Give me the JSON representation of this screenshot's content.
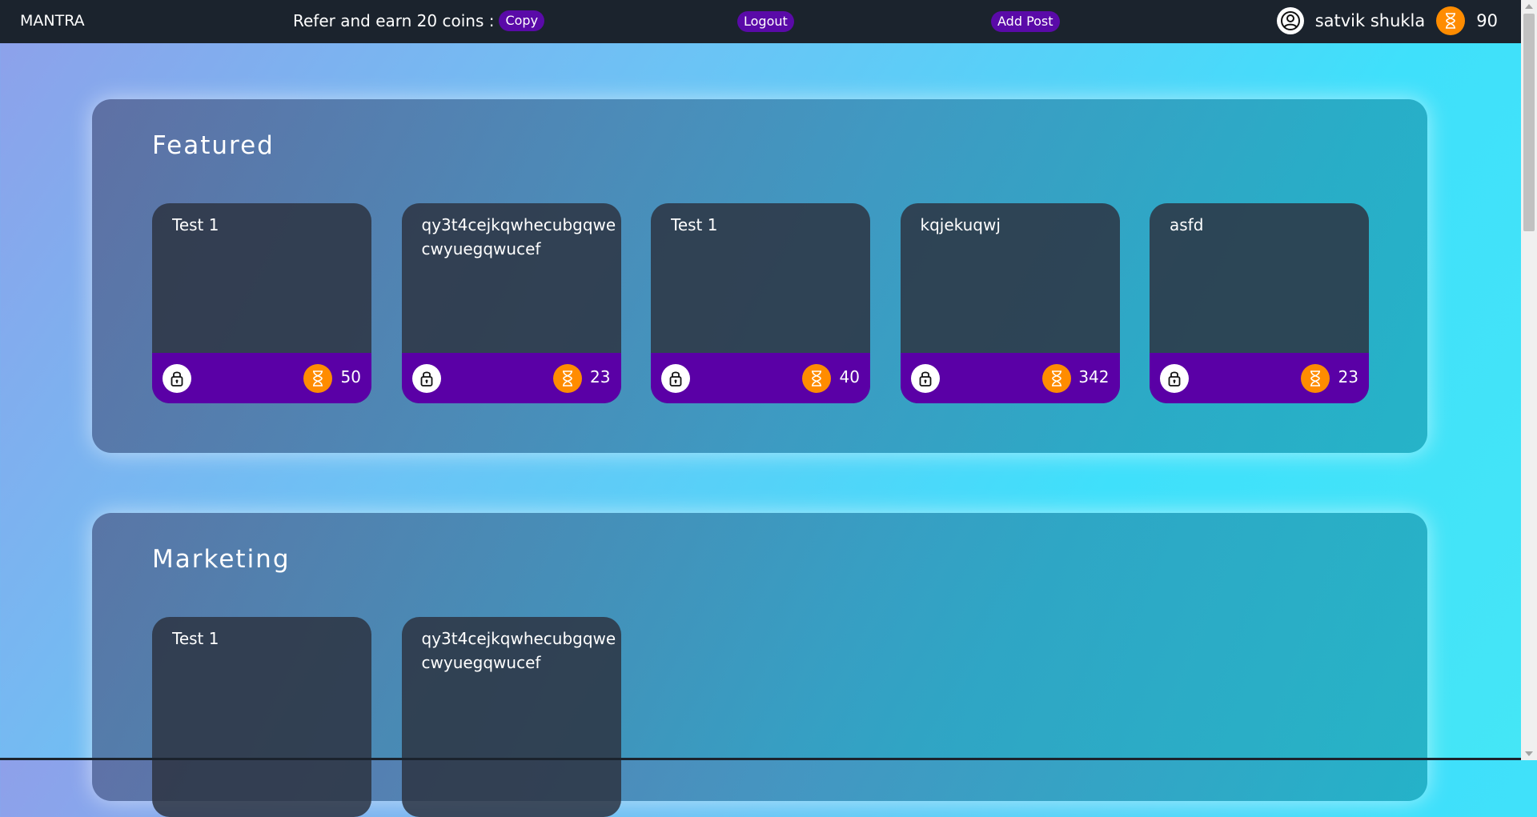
{
  "header": {
    "brand": "MANTRA",
    "refer_text": "Refer and earn 20 coins :",
    "copy_label": "Copy",
    "logout_label": "Logout",
    "add_post_label": "Add Post",
    "user_name": "satvik shukla",
    "coins": "90"
  },
  "sections": [
    {
      "title": "Featured",
      "cards": [
        {
          "title": "Test 1",
          "price": "50"
        },
        {
          "title": "qy3t4cejkqwhecubgqwecwyuegqwucef",
          "price": "23"
        },
        {
          "title": "Test 1",
          "price": "40"
        },
        {
          "title": "kqjekuqwj",
          "price": "342"
        },
        {
          "title": "asfd",
          "price": "23"
        }
      ]
    },
    {
      "title": "Marketing",
      "cards": [
        {
          "title": "Test 1"
        },
        {
          "title": "qy3t4cejkqwhecubgqwecwyuegqwucef"
        }
      ]
    }
  ],
  "colors": {
    "topbar": "#1b232d",
    "accent_purple": "#5a0aa8",
    "coin_orange": "#ff8c00"
  },
  "icons": {
    "avatar": "user-circle-icon",
    "coin": "hourglass-icon",
    "lock": "lock-icon"
  }
}
